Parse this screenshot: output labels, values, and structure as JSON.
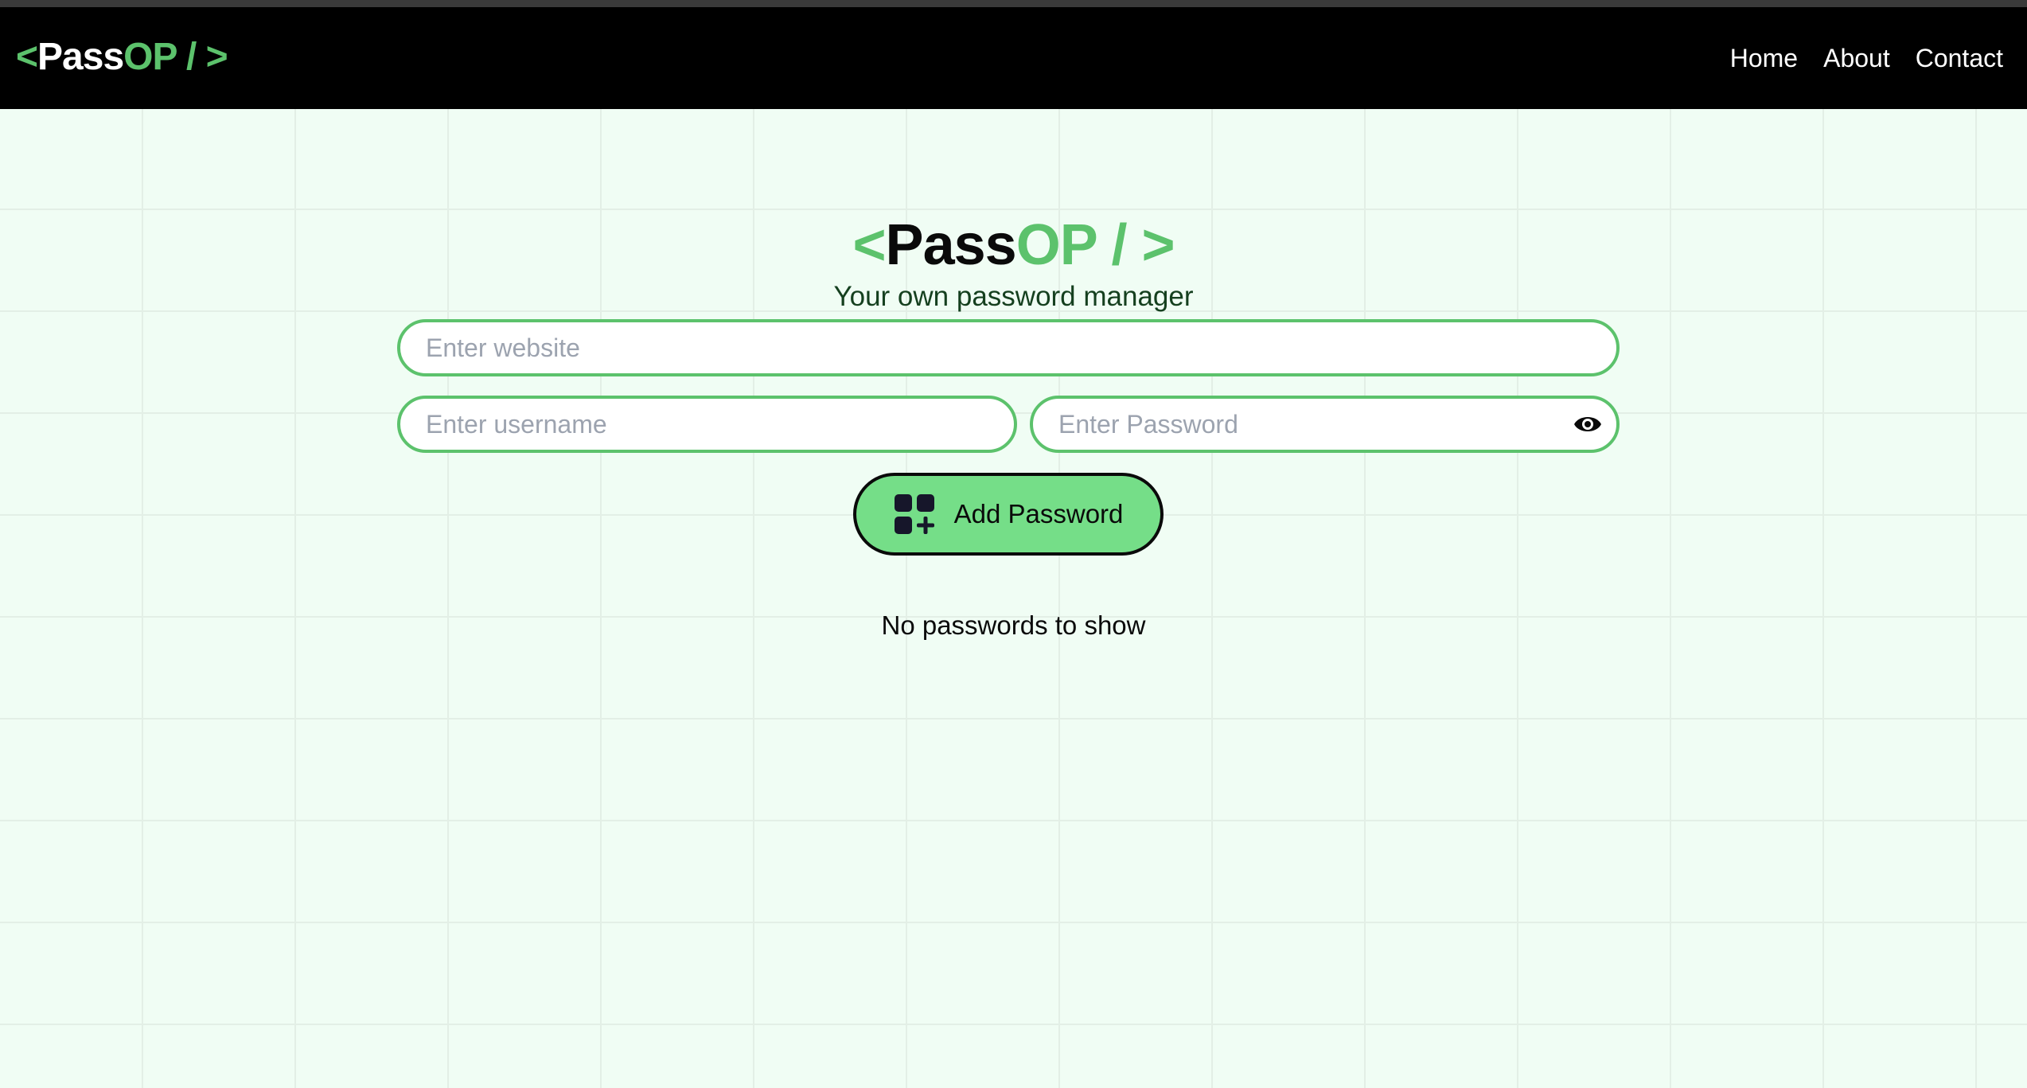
{
  "brand": {
    "open": "<",
    "pass": "Pass",
    "op": "OP",
    "close": " / >"
  },
  "nav": {
    "home": "Home",
    "about": "About",
    "contact": "Contact"
  },
  "hero": {
    "subtitle": "Your own password manager"
  },
  "form": {
    "website_placeholder": "Enter website",
    "website_value": "",
    "username_placeholder": "Enter username",
    "username_value": "",
    "password_placeholder": "Enter Password",
    "password_value": "",
    "password_toggle_icon": "eye-icon",
    "add_button_label": "Add Password",
    "add_button_icon": "add-grid-icon"
  },
  "passwords": {
    "empty_message": "No passwords to show",
    "items": []
  },
  "colors": {
    "accent_green": "#5cc26c",
    "button_green": "#75de88",
    "navbar": "#000000",
    "page_background": "#f0fdf4",
    "subtitle_text": "#15401f"
  }
}
